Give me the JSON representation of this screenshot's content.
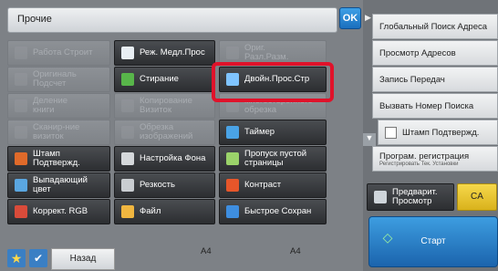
{
  "header": {
    "title": "Прочие",
    "ok_label": "OK"
  },
  "grid": [
    {
      "label": "Работа Строит",
      "enabled": false,
      "icon": "blank-icon"
    },
    {
      "label": "Реж. Медл.Прос",
      "enabled": true,
      "icon": "document-icon"
    },
    {
      "label": "Ориг.\nРазл.Разм.",
      "enabled": false,
      "icon": "blank-icon"
    },
    {
      "label": "Оригиналь\nПодсчет",
      "enabled": false,
      "icon": "blank-icon"
    },
    {
      "label": "Стирание",
      "enabled": true,
      "icon": "eraser-icon"
    },
    {
      "label": "Двойн.Прос.Стр",
      "enabled": true,
      "icon": "duplex-scan-icon"
    },
    {
      "label": "Деление\nкниги",
      "enabled": false,
      "icon": "blank-icon"
    },
    {
      "label": "Копирование\nВизиток",
      "enabled": false,
      "icon": "blank-icon"
    },
    {
      "label": "многостороннего\nобрезка",
      "enabled": false,
      "icon": "blank-icon"
    },
    {
      "label": "Сканир-ние\nвизиток",
      "enabled": false,
      "icon": "blank-icon"
    },
    {
      "label": "Обрезка\nизображений",
      "enabled": false,
      "icon": "blank-icon"
    },
    {
      "label": "Таймер",
      "enabled": true,
      "icon": "clock-icon"
    },
    {
      "label": "Штамп\nПодтвержд.",
      "enabled": true,
      "icon": "stamp-icon"
    },
    {
      "label": "Настройка Фона",
      "enabled": true,
      "icon": "background-icon"
    },
    {
      "label": "Пропуск пустой\nстраницы",
      "enabled": true,
      "icon": "skip-blank-icon"
    },
    {
      "label": "Выпадающий\nцвет",
      "enabled": true,
      "icon": "dropout-color-icon"
    },
    {
      "label": "Резкость",
      "enabled": true,
      "icon": "sharpness-icon"
    },
    {
      "label": "Контраст",
      "enabled": true,
      "icon": "contrast-icon"
    },
    {
      "label": "Коррект. RGB",
      "enabled": true,
      "icon": "rgb-icon"
    },
    {
      "label": "Файл",
      "enabled": true,
      "icon": "folder-icon"
    },
    {
      "label": "Быстрое Сохран",
      "enabled": true,
      "icon": "quick-save-icon"
    }
  ],
  "right_menu": [
    "Глобальный Поиск Адреса",
    "Просмотр Адресов",
    "Запись Передач",
    "Вызвать Номер Поиска",
    "Штамп Подтвержд."
  ],
  "program_reg": {
    "label": "Програм. регистрация",
    "sub": "Регистрировать Тек. Установки"
  },
  "actions": {
    "preview": "Предварит.\nПросмотр",
    "ca": "CA",
    "start": "Старт"
  },
  "bottom": {
    "back": "Назад",
    "size1": "A4",
    "size2": "A4"
  },
  "colors": {
    "start": "#1b64ad",
    "ca": "#d9b21c",
    "highlight": "#e0122a"
  }
}
